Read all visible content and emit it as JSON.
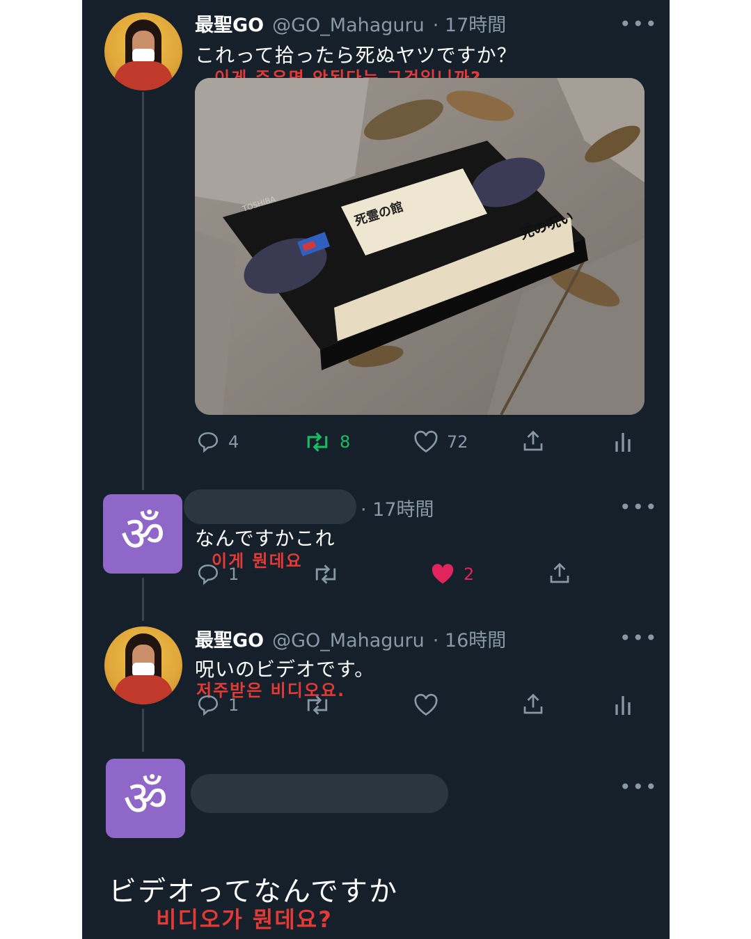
{
  "tweet1": {
    "name": "最聖GO",
    "handle": "@GO_Mahaguru",
    "time": "· 17時間",
    "text": "これって拾ったら死ぬヤツですか？",
    "translation": "이게 주우면 안된다는 그것입니까?",
    "more": "•••",
    "actions": {
      "reply_count": "4",
      "retweet_count": "8",
      "like_count": "72"
    },
    "photo": {
      "brand": "TOSHIBA",
      "spine_title": "死の呪い",
      "label_title": "死霊の館"
    }
  },
  "reply1": {
    "time": "· 17時間",
    "text": "なんですかこれ",
    "translation": "이게 뭔데요",
    "more": "•••",
    "actions": {
      "reply_count": "1",
      "like_count": "2"
    }
  },
  "tweet2": {
    "name": "最聖GO",
    "handle": "@GO_Mahaguru",
    "time": "· 16時間",
    "text": "呪いのビデオです。",
    "translation": "저주받은 비디오요.",
    "more": "•••",
    "actions": {
      "reply_count": "1"
    }
  },
  "reply2": {
    "more": "•••",
    "text": "ビデオってなんですか",
    "translation": "비디오가 뭔데요?"
  },
  "colors": {
    "background": "#15202b",
    "retweet_active": "#17bf63",
    "like_active": "#e0245e",
    "translation": "#e53935",
    "om_avatar": "#8e67c9"
  },
  "icons": [
    "reply-icon",
    "retweet-icon",
    "like-icon",
    "share-icon",
    "analytics-icon",
    "om-icon",
    "more-icon"
  ]
}
